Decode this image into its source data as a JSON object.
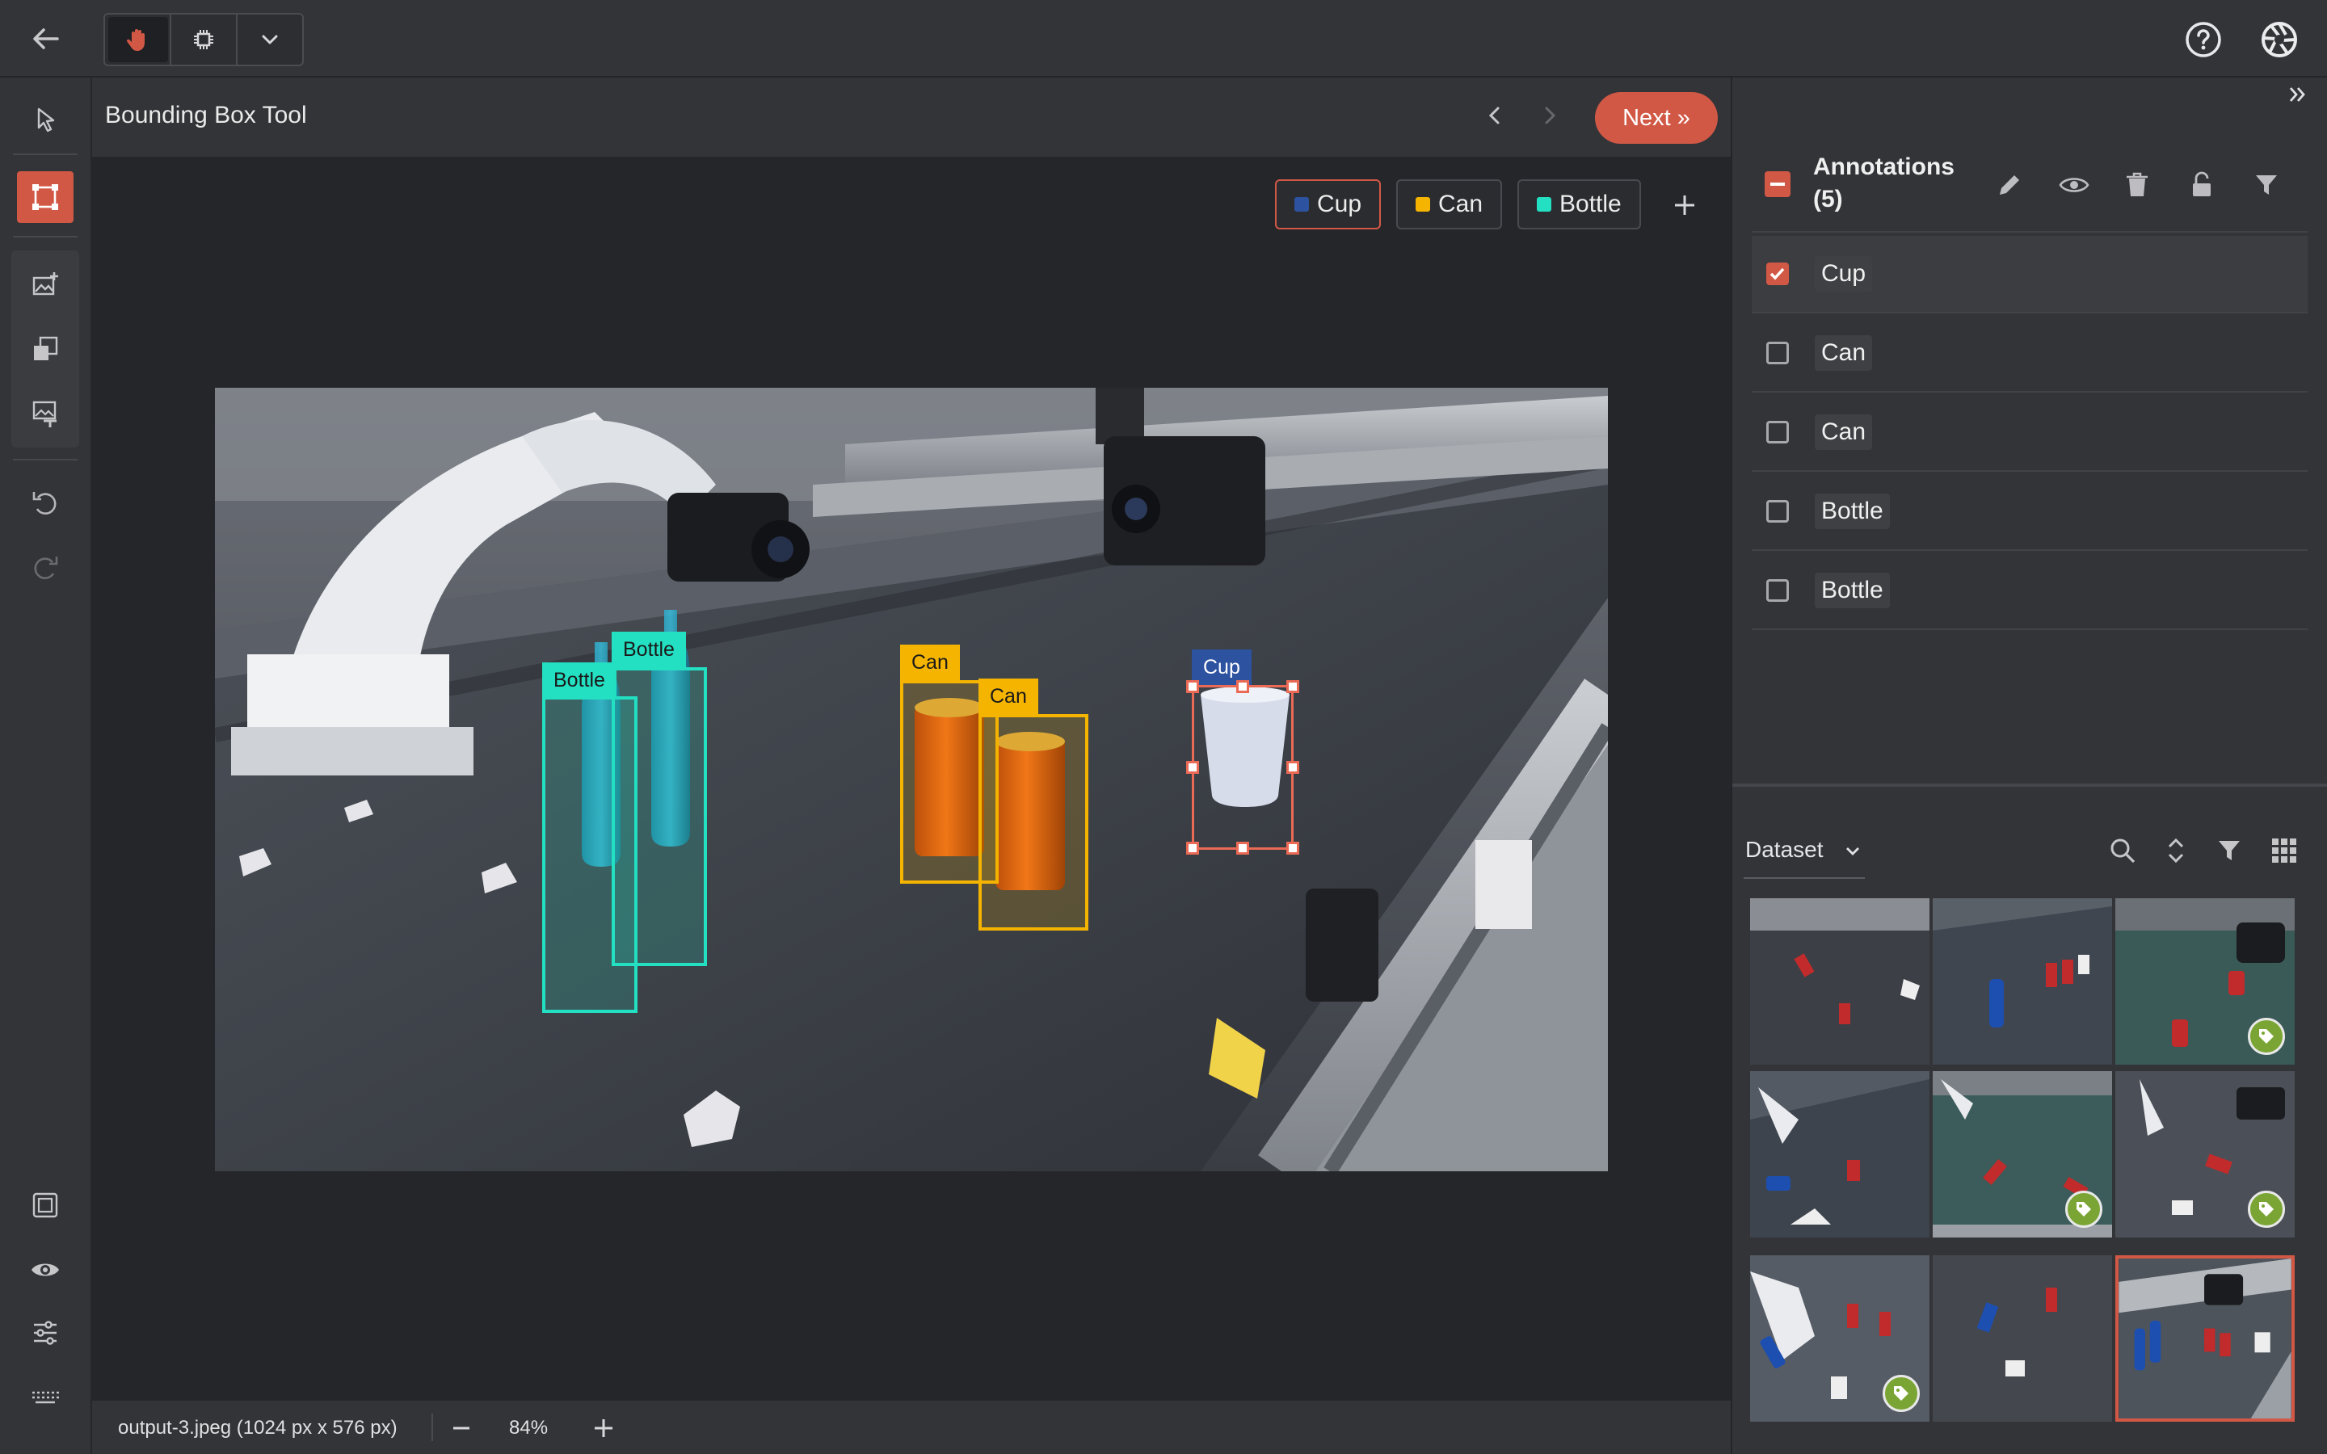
{
  "toolbar": {
    "back_icon": "arrow-left-icon",
    "mode_hand_icon": "hand-icon",
    "mode_chip_icon": "chip-icon",
    "mode_dropdown_icon": "chevron-down-icon",
    "help_icon": "help-circle-icon",
    "logo_icon": "aperture-logo-icon"
  },
  "left_tools": [
    "select-arrow-icon",
    "bounding-box-icon",
    "image-add-icon",
    "image-copy-icon",
    "image-text-icon",
    "undo-icon",
    "redo-icon",
    "fit-screen-icon",
    "eye-icon",
    "sliders-icon",
    "keyboard-icon"
  ],
  "title": {
    "tool_name": "Bounding Box Tool",
    "next_label": "Next »",
    "prev_icon": "chevron-left-icon",
    "next_icon": "chevron-right-icon"
  },
  "classes": [
    {
      "name": "Cup",
      "color": "#2c52a0",
      "selected": true
    },
    {
      "name": "Can",
      "color": "#f5b400"
    },
    {
      "name": "Bottle",
      "color": "#23e0c2"
    }
  ],
  "add_class_icon": "plus-icon",
  "boxes": [
    {
      "label": "Bottle",
      "color": "#23e0c2"
    },
    {
      "label": "Bottle",
      "color": "#23e0c2"
    },
    {
      "label": "Can",
      "color": "#f5b400"
    },
    {
      "label": "Can",
      "color": "#f5b400"
    },
    {
      "label": "Cup",
      "color": "#2c52a0"
    }
  ],
  "annotations": {
    "title": "Annotations",
    "count": "(5)",
    "tool_icons": [
      "pencil-icon",
      "eye-icon",
      "trash-icon",
      "unlock-icon",
      "filter-icon"
    ],
    "items": [
      {
        "label": "Cup",
        "checked": true
      },
      {
        "label": "Can",
        "checked": false
      },
      {
        "label": "Can",
        "checked": false
      },
      {
        "label": "Bottle",
        "checked": false
      },
      {
        "label": "Bottle",
        "checked": false
      }
    ]
  },
  "dataset": {
    "label": "Dataset",
    "tool_icons": [
      "search-icon",
      "sort-icon",
      "filter-icon",
      "grid-icon"
    ],
    "thumbs_tagged": [
      false,
      false,
      true,
      false,
      true,
      true,
      true,
      false,
      false
    ],
    "selected_thumb": 8
  },
  "status": {
    "filename": "output-3.jpeg (1024 px x 576 px)",
    "zoom": "84%"
  },
  "colors": {
    "accent": "#d25846",
    "panel": "#333438",
    "canvas": "#252629"
  }
}
